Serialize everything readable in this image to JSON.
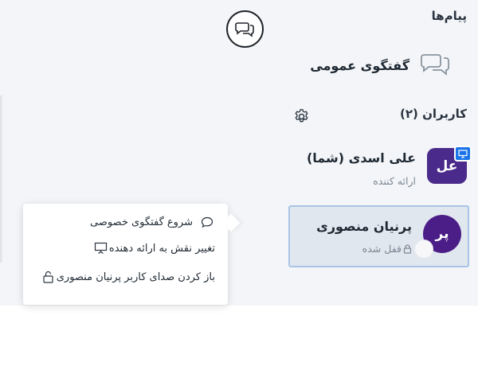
{
  "messages": {
    "title": "پیام‌ها",
    "public_chat_label": "گفتگوی عمومی"
  },
  "users": {
    "title": "کاربران (۲)",
    "list": [
      {
        "initials": "عل",
        "name": "علی اسدی (شما)",
        "role": "ارائه کننده",
        "presenter": true,
        "color": "#4a2a8a"
      },
      {
        "initials": "پر",
        "name": "پرنیان منصوری",
        "role": "قفل شده",
        "color": "#4b1e87"
      }
    ]
  },
  "context_menu": {
    "items": [
      {
        "label": "شروع گفتگوی خصوصی",
        "icon": "chat-bubble-icon"
      },
      {
        "label": "تغییر نقش به ارائه دهنده",
        "icon": "presentation-icon"
      },
      {
        "label": "باز کردن صدای کاربر پرنیان منصوری",
        "icon": "unlock-icon"
      }
    ]
  },
  "colors": {
    "panel_bg": "#f3f5f8",
    "avatar": "#4a2a8a",
    "selected_bg": "#e1e7ef",
    "selected_border": "#a9c4e6",
    "presenter_badge": "#1a73e8"
  }
}
